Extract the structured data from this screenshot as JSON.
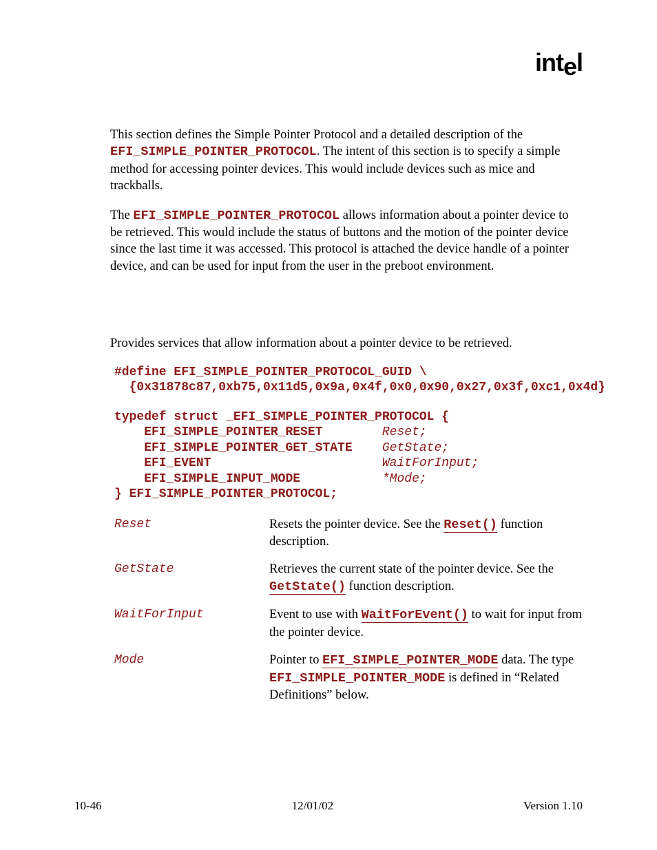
{
  "logo_text": "intel",
  "intro": {
    "para1_prefix": "This section defines the Simple Pointer Protocol and a detailed description of the ",
    "para1_code": "EFI_SIMPLE_POINTER_PROTOCOL",
    "para1_suffix": ".  The intent of this section is to specify a simple method for accessing pointer devices.  This would include devices such as mice and trackballs.",
    "para2_prefix": "The ",
    "para2_code": "EFI_SIMPLE_POINTER_PROTOCOL",
    "para2_suffix": " allows information about a pointer device to be retrieved.  This would include the status of buttons and the motion of the pointer device since the last time it was accessed.  This protocol is attached the device handle of a pointer device, and can be used for input from the user in the preboot environment."
  },
  "summary": "Provides services that allow information about a pointer device to be retrieved.",
  "guid_block": "#define EFI_SIMPLE_POINTER_PROTOCOL_GUID \\\n  {0x31878c87,0xb75,0x11d5,0x9a,0x4f,0x0,0x90,0x27,0x3f,0xc1,0x4d}",
  "struct_open": "typedef struct _EFI_SIMPLE_POINTER_PROTOCOL {",
  "struct_line1_type": "    EFI_SIMPLE_POINTER_RESET        ",
  "struct_line1_member": "Reset;",
  "struct_line2_type": "    EFI_SIMPLE_POINTER_GET_STATE    ",
  "struct_line2_member": "GetState;",
  "struct_line3_type": "    EFI_EVENT                       ",
  "struct_line3_member": "WaitForInput;",
  "struct_line4_type": "    EFI_SIMPLE_INPUT_MODE           ",
  "struct_line4_member": "*Mode;",
  "struct_close": "} EFI_SIMPLE_POINTER_PROTOCOL;",
  "params": {
    "reset": {
      "name": "Reset",
      "d1": "Resets the pointer device.  See the ",
      "link": "Reset()",
      "d2": " function description."
    },
    "getstate": {
      "name": "GetState",
      "d1": "Retrieves the current state of the pointer device.  See the ",
      "link": "GetState()",
      "d2": " function description."
    },
    "wait": {
      "name": "WaitForInput",
      "d1": "Event to use with ",
      "link": "WaitForEvent()",
      "d2": " to wait for input from the pointer device."
    },
    "mode": {
      "name": "Mode",
      "d1": "Pointer to ",
      "link": "EFI_SIMPLE_POINTER_MODE",
      "d2": " data.  The type ",
      "code2": "EFI_SIMPLE_POINTER_MODE",
      "d3": " is defined in “Related Definitions” below."
    }
  },
  "footer": {
    "left": "10-46",
    "center": "12/01/02",
    "right": "Version 1.10"
  }
}
